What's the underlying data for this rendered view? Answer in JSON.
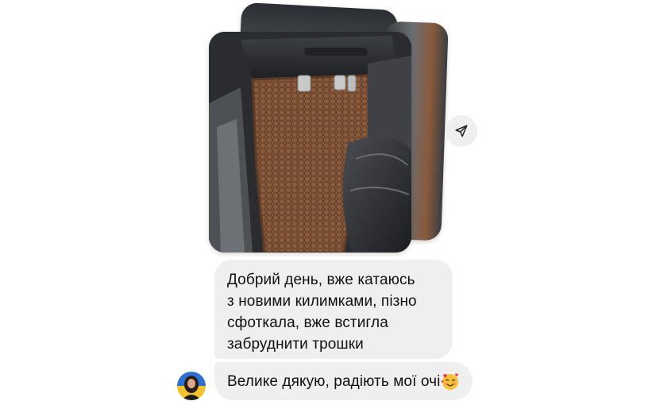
{
  "conversation": {
    "photo": {
      "description_icon": "car-floor-mat-photo"
    },
    "share_icon": "send-arrow-icon",
    "messages": [
      {
        "lines": [
          "Добрий день, вже катаюсь",
          "з новими килимками, пізно",
          "сфоткала, вже встигла",
          "забруднити трошки"
        ]
      },
      {
        "text": "Велике дякую, радіють мої очі",
        "emoji": "smiling-face-with-hearts"
      }
    ],
    "sender": {
      "avatar_icon": "user-avatar"
    }
  },
  "colors": {
    "bubble_bg": "#efefef",
    "text": "#111111",
    "mat_brown": "#8a5a3c"
  }
}
